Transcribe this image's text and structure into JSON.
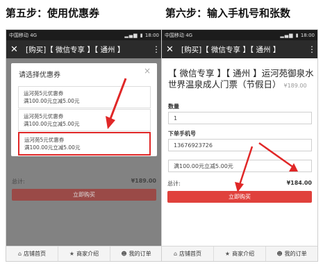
{
  "steps": {
    "left_title": "第五步：使用优惠券",
    "right_title": "第六步：输入手机号和张数"
  },
  "phone": {
    "carrier": "中国移动 4G",
    "time": "18:00",
    "app_title": "[购买]【 微信专享 】【 通州 】"
  },
  "coupon_modal": {
    "title": "请选择优惠券",
    "coupons": [
      {
        "name": "运河苑5元优惠券",
        "rule": "满100.00元立减5.00元"
      },
      {
        "name": "运河苑5元优惠券",
        "rule": "满100.00元立减5.00元"
      },
      {
        "name": "运河苑5元优惠券",
        "rule": "满100.00元立减5.00元"
      }
    ]
  },
  "left_order": {
    "total_label": "总计:",
    "total_amount": "¥189.00",
    "buy_label": "立即购买"
  },
  "product": {
    "title": "【 微信专享 】【 通州 】运河苑御泉水世界温泉成人门票（节假日）",
    "price": "¥189.00"
  },
  "form": {
    "quantity_label": "数量",
    "quantity_value": "1",
    "phone_label": "下单手机号",
    "phone_value": "13676923726",
    "coupon_value": "满100.00元立减5.00元"
  },
  "right_order": {
    "total_label": "总计:",
    "total_amount": "¥184.00",
    "buy_label": "立即购买"
  },
  "bottom_nav": {
    "home": "店铺首页",
    "merchant": "商家介绍",
    "orders": "我的订单"
  },
  "colors": {
    "accent_red": "#e0413c",
    "highlight_red": "#e02727",
    "appbar": "#2b2b2b"
  }
}
